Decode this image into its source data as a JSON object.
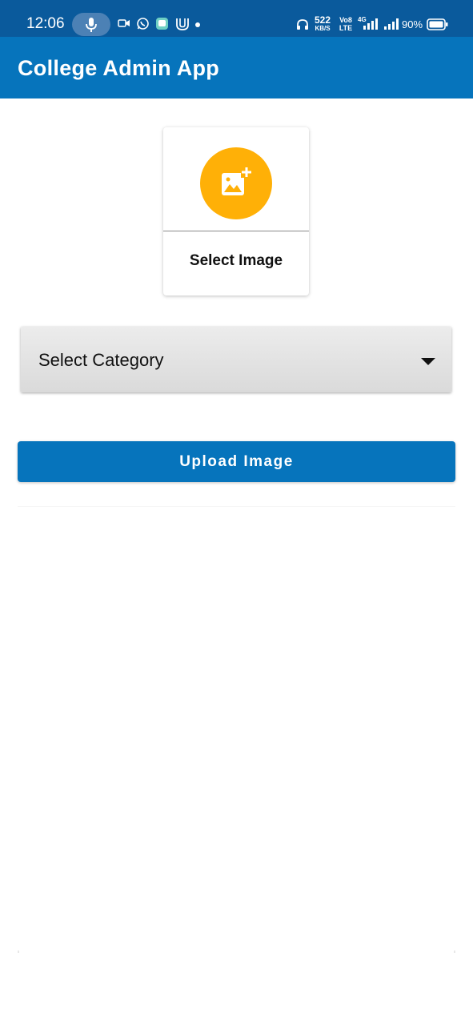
{
  "status_bar": {
    "time": "12:06",
    "net_speed": "522",
    "net_speed_unit": "KB/S",
    "volte_line1": "Vo8",
    "volte_line2": "LTE",
    "network_type": "4G",
    "battery_percent": "90%",
    "icons": [
      "mic-icon",
      "video-call-icon",
      "whatsapp-icon",
      "chat-app-icon",
      "u-app-icon",
      "headphones-icon",
      "signal-icon",
      "battery-icon"
    ]
  },
  "app_bar": {
    "title": "College Admin App"
  },
  "image_picker": {
    "label": "Select Image",
    "icon": "add-photo-icon",
    "accent_color": "#ffb007"
  },
  "category": {
    "placeholder": "Select Category",
    "icon": "dropdown-arrow-icon"
  },
  "upload": {
    "label": "Upload Image"
  },
  "colors": {
    "status_bar": "#0a5a9c",
    "primary": "#0674bc",
    "background": "#ffffff"
  }
}
